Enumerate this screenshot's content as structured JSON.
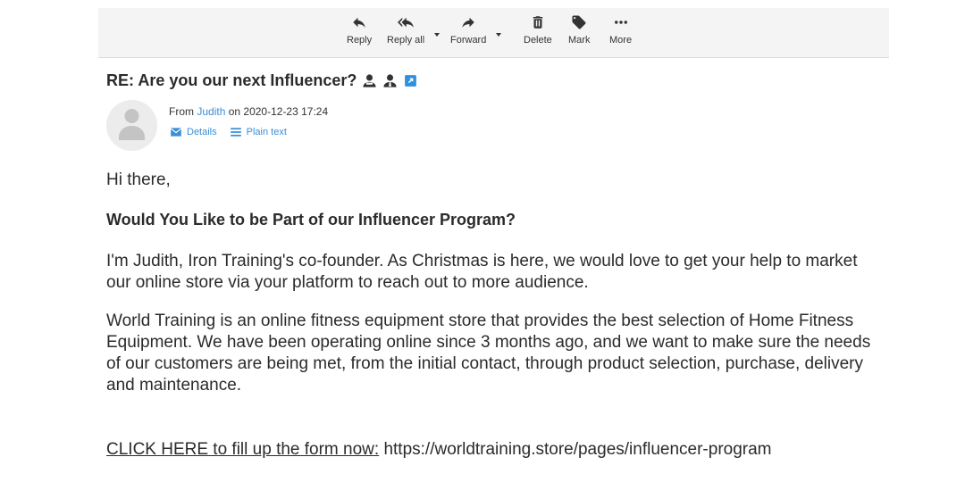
{
  "toolbar": {
    "buttons": [
      {
        "label": "Reply",
        "icon": "reply-icon"
      },
      {
        "label": "Reply all",
        "icon": "reply-all-icon"
      },
      {
        "label": "Forward",
        "icon": "forward-icon"
      },
      {
        "label": "Delete",
        "icon": "trash-icon"
      },
      {
        "label": "Mark",
        "icon": "tag-icon"
      },
      {
        "label": "More",
        "icon": "more-icon"
      }
    ]
  },
  "message": {
    "subject": "RE: Are you our next Influencer?",
    "subject_icons": [
      "user-icon",
      "user-icon",
      "external-link-icon"
    ],
    "from_prefix": "From",
    "sender": "Judith",
    "date_text": "on 2020-12-23 17:24",
    "details_label": "Details",
    "plain_text_label": "Plain text"
  },
  "body": {
    "greeting": "Hi there,",
    "heading": "Would You Like to be Part of our Influencer Program?",
    "para1": "I'm Judith, Iron Training's co-founder. As Christmas is here, we would love to get your help to market our online store via your platform to reach out to more audience.",
    "para2": "World Training is an online fitness equipment store that provides the best selection of Home Fitness Equipment. We have been operating online since 3 months ago, and we want to make sure the needs of our customers are being met, from the initial contact, through product selection, purchase, delivery and maintenance.",
    "cta_link": "CLICK HERE to fill up the form now:",
    "cta_url": " https://worldtraining.store/pages/influencer-program"
  },
  "colors": {
    "link": "#3a8fd6",
    "toolbar_bg": "#f4f4f4",
    "text": "#2b2b2b"
  }
}
